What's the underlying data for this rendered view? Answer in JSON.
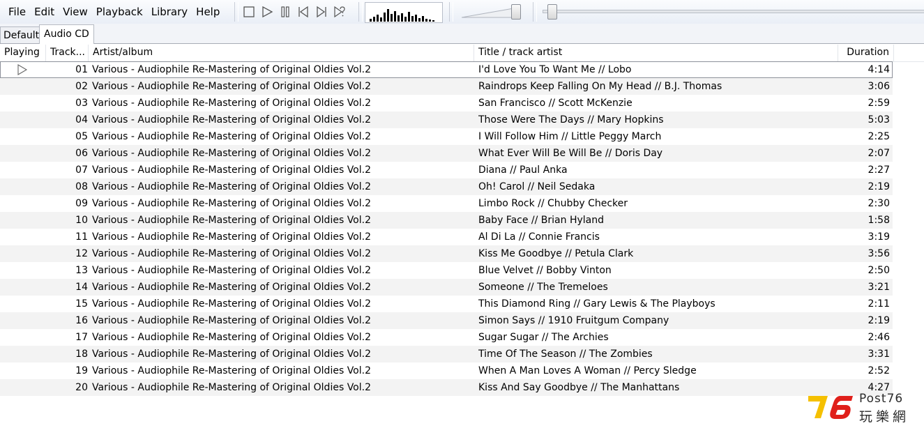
{
  "menu": [
    "File",
    "Edit",
    "View",
    "Playback",
    "Library",
    "Help"
  ],
  "transport_icons": [
    "stop-icon",
    "play-icon",
    "pause-icon",
    "previous-icon",
    "next-icon",
    "random-icon"
  ],
  "volume_level": 0.9,
  "seek_position": 0.02,
  "tabs": [
    {
      "label": "Default",
      "active": false
    },
    {
      "label": "Audio CD",
      "active": true
    }
  ],
  "columns": {
    "playing": "Playing",
    "track": "Track...",
    "artist": "Artist/album",
    "title": "Title / track artist",
    "duration": "Duration"
  },
  "tracks": [
    {
      "num": "01",
      "artist": "Various - Audiophile Re-Mastering of Original Oldies Vol.2",
      "title": "I'd Love You To Want Me // Lobo",
      "duration": "4:14"
    },
    {
      "num": "02",
      "artist": "Various - Audiophile Re-Mastering of Original Oldies Vol.2",
      "title": "Raindrops Keep Falling On My Head // B.J. Thomas",
      "duration": "3:06"
    },
    {
      "num": "03",
      "artist": "Various - Audiophile Re-Mastering of Original Oldies Vol.2",
      "title": "San Francisco // Scott McKenzie",
      "duration": "2:59"
    },
    {
      "num": "04",
      "artist": "Various - Audiophile Re-Mastering of Original Oldies Vol.2",
      "title": "Those Were The Days // Mary Hopkins",
      "duration": "5:03"
    },
    {
      "num": "05",
      "artist": "Various - Audiophile Re-Mastering of Original Oldies Vol.2",
      "title": "I Will Follow Him // Little Peggy March",
      "duration": "2:25"
    },
    {
      "num": "06",
      "artist": "Various - Audiophile Re-Mastering of Original Oldies Vol.2",
      "title": "What Ever Will Be Will Be // Doris Day",
      "duration": "2:07"
    },
    {
      "num": "07",
      "artist": "Various - Audiophile Re-Mastering of Original Oldies Vol.2",
      "title": "Diana // Paul Anka",
      "duration": "2:27"
    },
    {
      "num": "08",
      "artist": "Various - Audiophile Re-Mastering of Original Oldies Vol.2",
      "title": "Oh! Carol // Neil Sedaka",
      "duration": "2:19"
    },
    {
      "num": "09",
      "artist": "Various - Audiophile Re-Mastering of Original Oldies Vol.2",
      "title": "Limbo Rock // Chubby Checker",
      "duration": "2:30"
    },
    {
      "num": "10",
      "artist": "Various - Audiophile Re-Mastering of Original Oldies Vol.2",
      "title": "Baby Face // Brian Hyland",
      "duration": "1:58"
    },
    {
      "num": "11",
      "artist": "Various - Audiophile Re-Mastering of Original Oldies Vol.2",
      "title": "Al Di La // Connie Francis",
      "duration": "3:19"
    },
    {
      "num": "12",
      "artist": "Various - Audiophile Re-Mastering of Original Oldies Vol.2",
      "title": "Kiss Me Goodbye // Petula Clark",
      "duration": "3:56"
    },
    {
      "num": "13",
      "artist": "Various - Audiophile Re-Mastering of Original Oldies Vol.2",
      "title": "Blue Velvet // Bobby Vinton",
      "duration": "2:50"
    },
    {
      "num": "14",
      "artist": "Various - Audiophile Re-Mastering of Original Oldies Vol.2",
      "title": "Someone // The Tremeloes",
      "duration": "3:21"
    },
    {
      "num": "15",
      "artist": "Various - Audiophile Re-Mastering of Original Oldies Vol.2",
      "title": "This Diamond Ring // Gary Lewis & The Playboys",
      "duration": "2:11"
    },
    {
      "num": "16",
      "artist": "Various - Audiophile Re-Mastering of Original Oldies Vol.2",
      "title": "Simon Says // 1910 Fruitgum Company",
      "duration": "2:19"
    },
    {
      "num": "17",
      "artist": "Various - Audiophile Re-Mastering of Original Oldies Vol.2",
      "title": "Sugar Sugar // The Archies",
      "duration": "2:46"
    },
    {
      "num": "18",
      "artist": "Various - Audiophile Re-Mastering of Original Oldies Vol.2",
      "title": "Time Of The Season // The Zombies",
      "duration": "3:31"
    },
    {
      "num": "19",
      "artist": "Various - Audiophile Re-Mastering of Original Oldies Vol.2",
      "title": "When A Man Loves A Woman // Percy Sledge",
      "duration": "2:52"
    },
    {
      "num": "20",
      "artist": "Various - Audiophile Re-Mastering of Original Oldies Vol.2",
      "title": "Kiss And Say Goodbye // The Manhattans",
      "duration": "4:27"
    }
  ],
  "playing_index": 0,
  "watermark": {
    "number": "76",
    "text": "Post76",
    "cjk": "玩樂網",
    "colors": {
      "yellow": "#f5c000",
      "red": "#e0201b"
    }
  }
}
